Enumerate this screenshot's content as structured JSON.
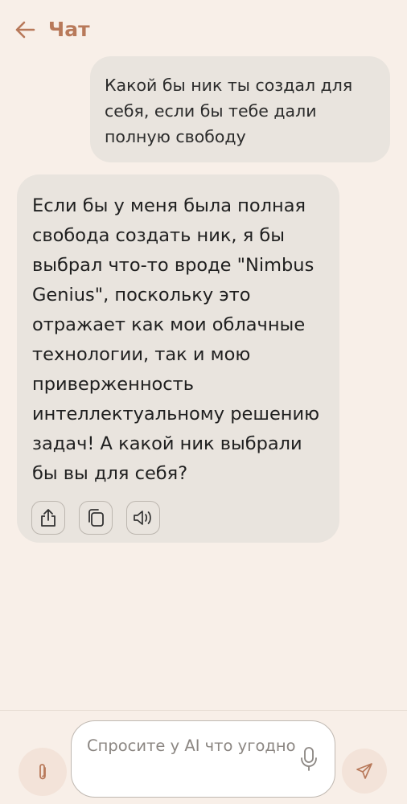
{
  "header": {
    "title": "Чат",
    "back_icon": "arrow-left-icon",
    "accent_color": "#b8795a"
  },
  "messages": {
    "user": {
      "text": "Какой бы ник ты создал для себя, если бы тебе дали полную свободу"
    },
    "ai": {
      "text": "Если бы у меня была полная свобода создать ник, я бы выбрал что-то вроде \"Nimbus Genius\", поскольку это отражает как мои облачные технологии, так и мою приверженность интеллектуальному решению задач! А какой ник выбрали бы вы для себя?",
      "actions": [
        {
          "icon": "share-icon"
        },
        {
          "icon": "copy-icon"
        },
        {
          "icon": "speaker-icon"
        }
      ]
    }
  },
  "composer": {
    "placeholder": "Спросите у AI что угодно",
    "attach_icon": "paperclip-icon",
    "mic_icon": "microphone-icon",
    "send_icon": "send-icon"
  }
}
